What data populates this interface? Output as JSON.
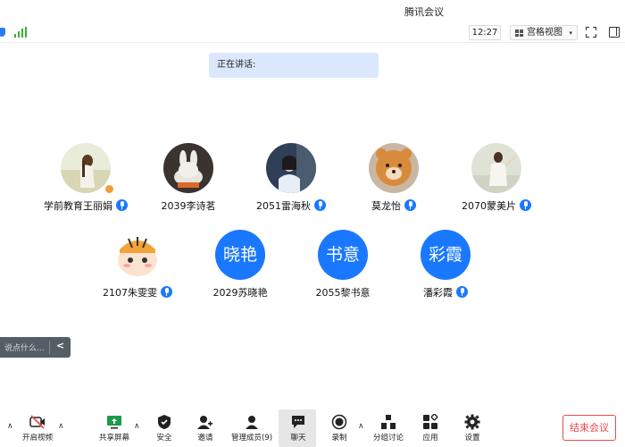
{
  "window": {
    "title": "腾讯会议"
  },
  "topbar": {
    "time": "12:27",
    "view_label": "宫格视图",
    "view_caret": "▾"
  },
  "speaking": {
    "label": "正在讲话:"
  },
  "participants": [
    {
      "name": "学前教育王丽娟",
      "avatar_type": "photo"
    },
    {
      "name": "2039李诗茗",
      "avatar_type": "photo"
    },
    {
      "name": "2051雷海秋",
      "avatar_type": "photo"
    },
    {
      "name": "莫龙怡",
      "avatar_type": "photo"
    },
    {
      "name": "2070蒙美片",
      "avatar_type": "photo"
    },
    {
      "name": "2107朱雯雯",
      "avatar_type": "photo"
    },
    {
      "name": "2029苏晓艳",
      "avatar_type": "text",
      "avatar_text": "晓艳"
    },
    {
      "name": "2055黎书意",
      "avatar_type": "text",
      "avatar_text": "书意"
    },
    {
      "name": "潘彩霞",
      "avatar_type": "text",
      "avatar_text": "彩霞"
    }
  ],
  "chat": {
    "placeholder": "说点什么...",
    "collapse": "<"
  },
  "toolbar": {
    "video": "开启视频",
    "share": "共享屏幕",
    "security": "安全",
    "invite": "邀请",
    "members": "管理成员(9)",
    "chat": "聊天",
    "record": "录制",
    "breakout": "分组讨论",
    "apps": "应用",
    "settings": "设置",
    "end": "结束会议"
  },
  "colors": {
    "accent": "#1a78ff",
    "end_red": "#e84a4a",
    "banner": "#dbe8fc"
  }
}
